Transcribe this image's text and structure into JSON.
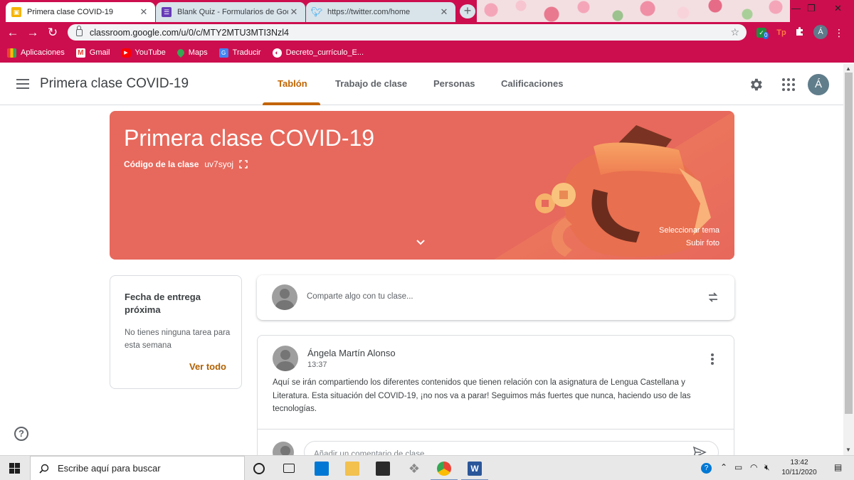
{
  "browser": {
    "tabs": [
      {
        "label": "Primera clase COVID-19",
        "active": true
      },
      {
        "label": "Blank Quiz - Formularios de Goog",
        "active": false
      },
      {
        "label": "https://twitter.com/home",
        "active": false
      }
    ],
    "new_tab_symbol": "+",
    "url": "classroom.google.com/u/0/c/MTY2MTU3MTI3Nzl4",
    "profile_initial": "Á",
    "ext_badge": "0",
    "ext_tp_label": "Tp"
  },
  "bookmarks": [
    {
      "label": "Aplicaciones",
      "icon": "apps-grid-icon"
    },
    {
      "label": "Gmail",
      "icon": "gmail-icon"
    },
    {
      "label": "YouTube",
      "icon": "youtube-icon"
    },
    {
      "label": "Maps",
      "icon": "maps-icon"
    },
    {
      "label": "Traducir",
      "icon": "translate-icon"
    },
    {
      "label": "Decreto_currículo_E...",
      "icon": "web-icon"
    }
  ],
  "classroom": {
    "class_title": "Primera clase COVID-19",
    "tabs": [
      {
        "label": "Tablón",
        "active": true
      },
      {
        "label": "Trabajo de clase",
        "active": false
      },
      {
        "label": "Personas",
        "active": false
      },
      {
        "label": "Calificaciones",
        "active": false
      }
    ],
    "user_initial": "Á"
  },
  "banner": {
    "title": "Primera clase COVID-19",
    "code_label": "Código de la clase",
    "code_value": "uv7syoj",
    "select_theme": "Seleccionar tema",
    "upload_photo": "Subir foto",
    "color": "#e7685c"
  },
  "upcoming": {
    "title": "Fecha de entrega próxima",
    "empty_text": "No tienes ninguna tarea para esta semana",
    "view_all": "Ver todo"
  },
  "share": {
    "placeholder": "Comparte algo con tu clase..."
  },
  "post": {
    "author": "Ángela Martín Alonso",
    "time": "13:37",
    "body": "Aquí se irán compartiendo los diferentes contenidos que tienen relación con la asignatura de Lengua Castellana y Literatura. Esta situación del COVID-19, ¡no nos va a parar! Seguimos más fuertes que nunca, haciendo uso de las tecnologías.",
    "comment_placeholder": "Añadir un comentario de clase..."
  },
  "help_symbol": "?",
  "taskbar": {
    "search_placeholder": "Escribe aquí para buscar",
    "time": "13:42",
    "date": "10/11/2020"
  },
  "colors": {
    "browser_theme": "#cc0e4e",
    "accent": "#c26401"
  }
}
